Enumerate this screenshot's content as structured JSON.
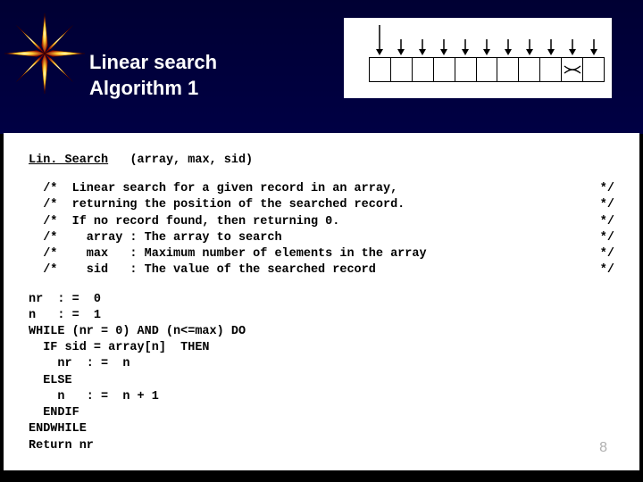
{
  "title": {
    "line1": "Linear search",
    "line2": "Algorithm 1"
  },
  "diagram": {
    "cells": 11,
    "x_index": 9,
    "first_arrow_tall": true
  },
  "proc": {
    "name": "Lin. Search",
    "params": "(array, max, sid)"
  },
  "comments": [
    "Linear search for a given record in an array,",
    "returning the position of the searched record.",
    "If no record found, then returning 0.",
    "  array : The array to search",
    "  max   : Maximum number of elements in the array",
    "  sid   : The value of the searched record"
  ],
  "comment_open": "/*",
  "comment_close": "*/",
  "code": "nr  : =  0\nn   : =  1\nWHILE (nr = 0) AND (n<=max) DO\n  IF sid = array[n]  THEN\n    nr  : =  n\n  ELSE\n    n   : =  n + 1\n  ENDIF\nENDWHILE\nReturn nr",
  "page_number": "8"
}
